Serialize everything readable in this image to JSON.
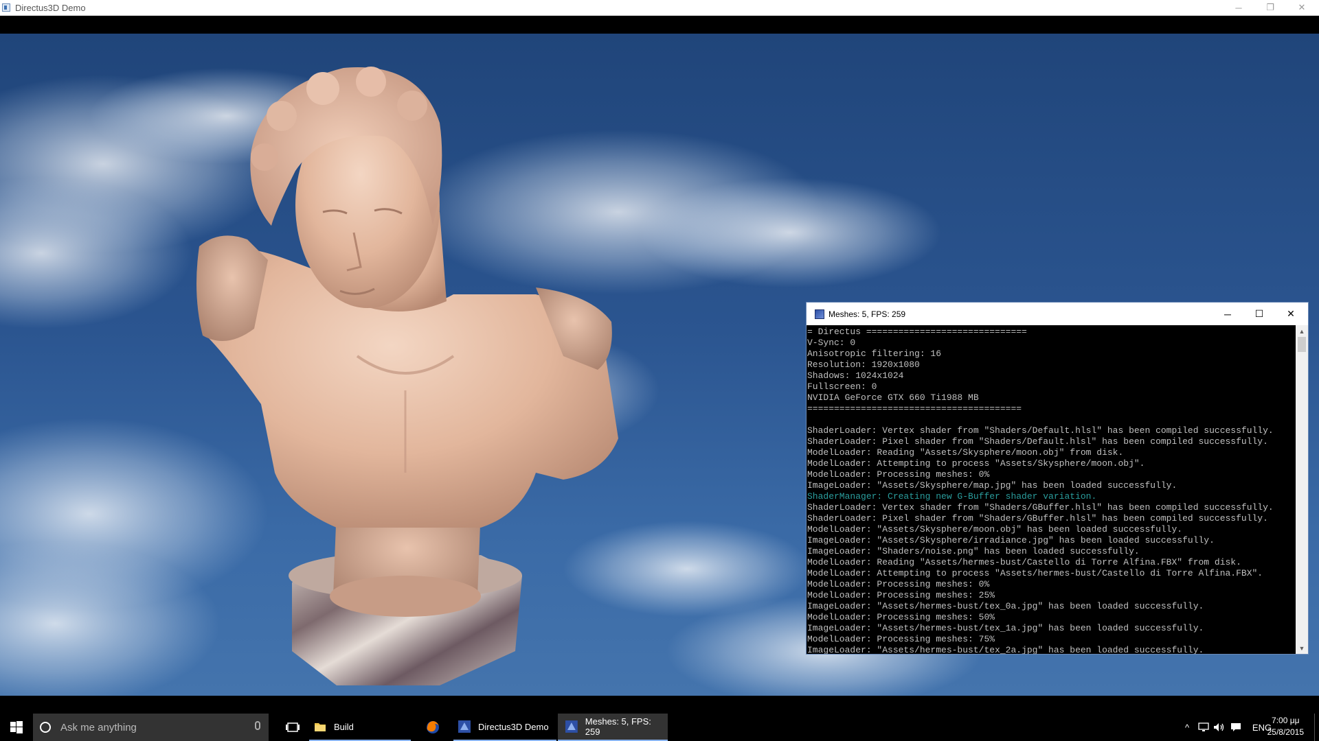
{
  "window": {
    "title": "Directus3D Demo",
    "minimize_icon": "─",
    "restore_icon": "❐",
    "close_icon": "✕"
  },
  "scene": {
    "subject": "marble-bust",
    "background": "sky-with-clouds"
  },
  "console": {
    "title": "Meshes: 5, FPS: 259",
    "minimize_icon": "─",
    "maximize_icon": "☐",
    "close_icon": "✕",
    "lines": [
      {
        "text": "= Directus ==============================",
        "type": "normal"
      },
      {
        "text": "V-Sync: 0",
        "type": "normal"
      },
      {
        "text": "Anisotropic filtering: 16",
        "type": "normal"
      },
      {
        "text": "Resolution: 1920x1080",
        "type": "normal"
      },
      {
        "text": "Shadows: 1024x1024",
        "type": "normal"
      },
      {
        "text": "Fullscreen: 0",
        "type": "normal"
      },
      {
        "text": "NVIDIA GeForce GTX 660 Ti1988 MB",
        "type": "normal"
      },
      {
        "text": "========================================",
        "type": "normal"
      },
      {
        "text": "",
        "type": "normal"
      },
      {
        "text": "ShaderLoader: Vertex shader from \"Shaders/Default.hlsl\" has been compiled successfully.",
        "type": "normal"
      },
      {
        "text": "ShaderLoader: Pixel shader from \"Shaders/Default.hlsl\" has been compiled successfully.",
        "type": "normal"
      },
      {
        "text": "ModelLoader: Reading \"Assets/Skysphere/moon.obj\" from disk.",
        "type": "normal"
      },
      {
        "text": "ModelLoader: Attempting to process \"Assets/Skysphere/moon.obj\".",
        "type": "normal"
      },
      {
        "text": "ModelLoader: Processing meshes: 0%",
        "type": "normal"
      },
      {
        "text": "ImageLoader: \"Assets/Skysphere/map.jpg\" has been loaded successfully.",
        "type": "normal"
      },
      {
        "text": "ShaderManager: Creating new G-Buffer shader variation.",
        "type": "info"
      },
      {
        "text": "ShaderLoader: Vertex shader from \"Shaders/GBuffer.hlsl\" has been compiled successfully.",
        "type": "normal"
      },
      {
        "text": "ShaderLoader: Pixel shader from \"Shaders/GBuffer.hlsl\" has been compiled successfully.",
        "type": "normal"
      },
      {
        "text": "ModelLoader: \"Assets/Skysphere/moon.obj\" has been loaded successfully.",
        "type": "normal"
      },
      {
        "text": "ImageLoader: \"Assets/Skysphere/irradiance.jpg\" has been loaded successfully.",
        "type": "normal"
      },
      {
        "text": "ImageLoader: \"Shaders/noise.png\" has been loaded successfully.",
        "type": "normal"
      },
      {
        "text": "ModelLoader: Reading \"Assets/hermes-bust/Castello di Torre Alfina.FBX\" from disk.",
        "type": "normal"
      },
      {
        "text": "ModelLoader: Attempting to process \"Assets/hermes-bust/Castello di Torre Alfina.FBX\".",
        "type": "normal"
      },
      {
        "text": "ModelLoader: Processing meshes: 0%",
        "type": "normal"
      },
      {
        "text": "ModelLoader: Processing meshes: 25%",
        "type": "normal"
      },
      {
        "text": "ImageLoader: \"Assets/hermes-bust/tex_0a.jpg\" has been loaded successfully.",
        "type": "normal"
      },
      {
        "text": "ModelLoader: Processing meshes: 50%",
        "type": "normal"
      },
      {
        "text": "ImageLoader: \"Assets/hermes-bust/tex_1a.jpg\" has been loaded successfully.",
        "type": "normal"
      },
      {
        "text": "ModelLoader: Processing meshes: 75%",
        "type": "normal"
      },
      {
        "text": "ImageLoader: \"Assets/hermes-bust/tex_2a.jpg\" has been loaded successfully.",
        "type": "normal"
      }
    ],
    "scroll_up_icon": "▲",
    "scroll_down_icon": "▼",
    "colors": {
      "text": "#c0c0c0",
      "info": "#2a9d9d",
      "background": "#000000"
    }
  },
  "taskbar": {
    "search_placeholder": "Ask me anything",
    "apps": [
      {
        "label": "Build",
        "icon": "folder-icon",
        "state": "running"
      },
      {
        "label": "",
        "icon": "firefox-icon",
        "state": "pinned"
      },
      {
        "label": "Directus3D Demo",
        "icon": "directus-icon",
        "state": "running"
      },
      {
        "label": "Meshes: 5, FPS: 259",
        "icon": "directus-icon",
        "state": "active"
      }
    ],
    "tray": {
      "chevron": "^",
      "language": "ENG"
    },
    "clock": {
      "time": "7:00 μμ",
      "date": "25/8/2015"
    }
  }
}
